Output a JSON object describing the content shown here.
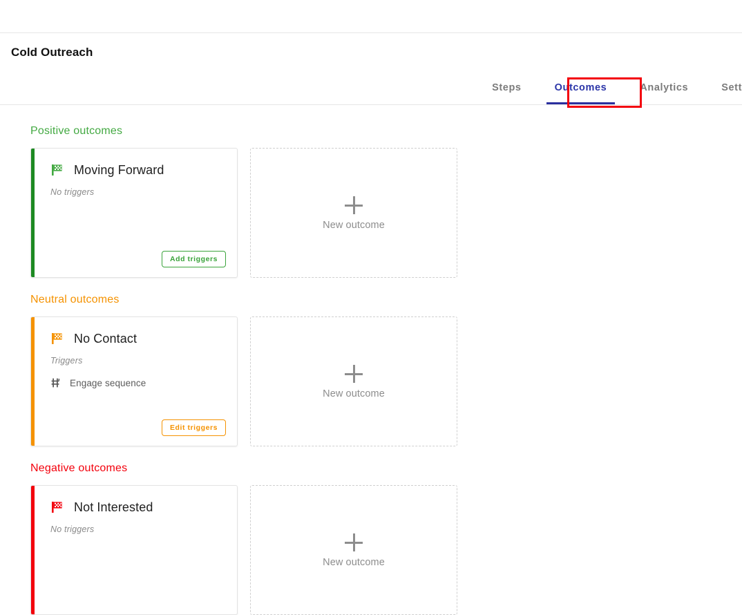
{
  "header": {
    "title": "Cold Outreach"
  },
  "tabs": [
    {
      "label": "Steps",
      "active": false
    },
    {
      "label": "Outcomes",
      "active": true
    },
    {
      "label": "Analytics",
      "active": false
    },
    {
      "label": "Sett",
      "active": false
    }
  ],
  "colors": {
    "positive": "#43a942",
    "positive_bar": "#1d8a22",
    "neutral": "#f59200",
    "negative": "#f3000c",
    "active_tab": "#2b35a8",
    "highlight_box": "#f3000c",
    "muted_text": "#8d8d8d"
  },
  "new_card": {
    "label": "New outcome",
    "icon": "plus-icon"
  },
  "sections": [
    {
      "key": "positive",
      "title": "Positive outcomes",
      "card": {
        "name": "Moving Forward",
        "flag_icon": "checkered-flag-icon",
        "triggers_label": "No triggers",
        "triggers": [],
        "button_label": "Add triggers"
      }
    },
    {
      "key": "neutral",
      "title": "Neutral outcomes",
      "card": {
        "name": "No Contact",
        "flag_icon": "checkered-flag-icon",
        "triggers_label": "Triggers",
        "triggers": [
          {
            "label": "Engage sequence",
            "icon": "sequence-icon"
          }
        ],
        "button_label": "Edit triggers"
      }
    },
    {
      "key": "negative",
      "title": "Negative outcomes",
      "card": {
        "name": "Not Interested",
        "flag_icon": "checkered-flag-icon",
        "triggers_label": "No triggers",
        "triggers": [],
        "button_label": null
      }
    }
  ]
}
